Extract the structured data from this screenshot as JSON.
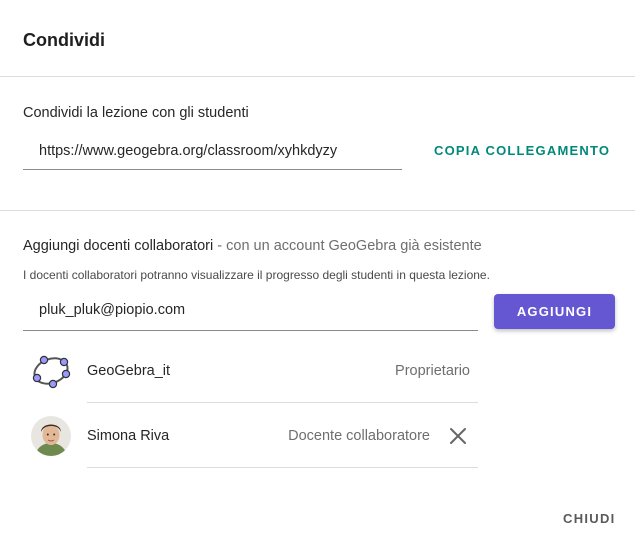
{
  "dialog": {
    "title": "Condividi",
    "share": {
      "label": "Condividi la lezione con gli studenti",
      "link_value": "https://www.geogebra.org/classroom/xyhkdyzy",
      "copy_label": "COPIA COLLEGAMENTO"
    },
    "collaborators": {
      "heading": "Aggiungi docenti collaboratori",
      "heading_sub": " - con un account GeoGebra già esistente",
      "description": "I docenti collaboratori potranno visualizzare il progresso degli studenti in questa lezione.",
      "email_value": "pluk_pluk@piopio.com",
      "add_label": "AGGIUNGI"
    },
    "members": [
      {
        "name": "GeoGebra_it",
        "role": "Proprietario",
        "avatar": "geogebra-logo-icon"
      },
      {
        "name": "Simona Riva",
        "role": "Docente collaboratore",
        "avatar": "user-photo",
        "remove_icon": "close-icon"
      }
    ],
    "close_label": "CHIUDI"
  },
  "colors": {
    "accent": "#6557d2",
    "link": "#00897b",
    "divider": "#dcdcdc"
  }
}
